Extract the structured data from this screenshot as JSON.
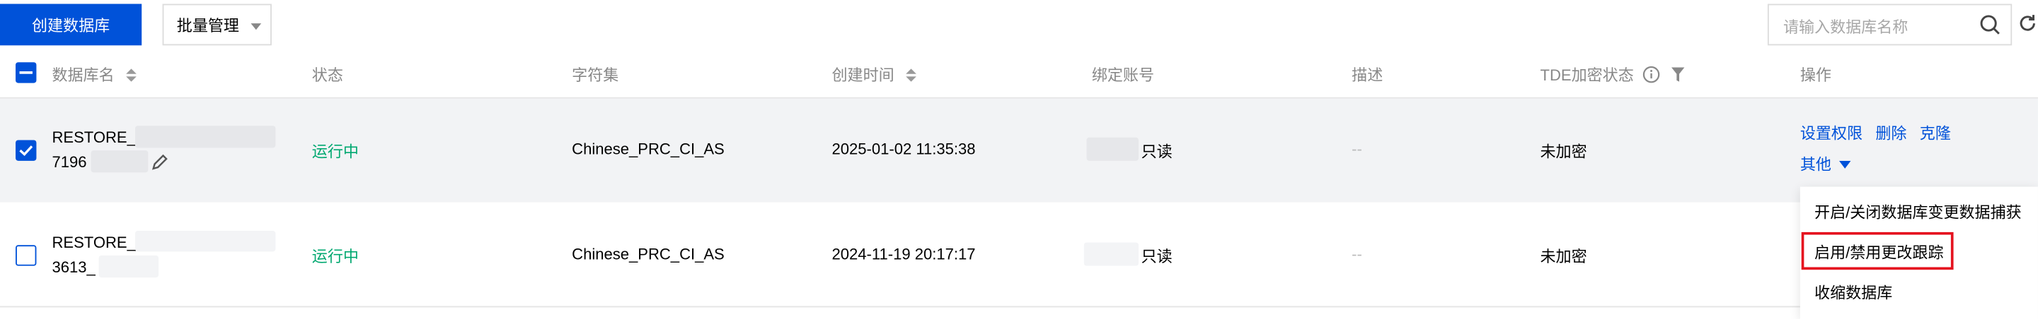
{
  "toolbar": {
    "create_label": "创建数据库",
    "batch_label": "批量管理",
    "search_placeholder": "请输入数据库名称"
  },
  "table": {
    "columns": {
      "name": "数据库名",
      "status": "状态",
      "charset": "字符集",
      "created": "创建时间",
      "account": "绑定账号",
      "desc": "描述",
      "tde": "TDE加密状态",
      "actions": "操作"
    },
    "rows": [
      {
        "name_line1": "RESTORE_",
        "name_line2": "7196",
        "status": "运行中",
        "charset": "Chinese_PRC_CI_AS",
        "created": "2025-01-02 11:35:38",
        "account": "只读",
        "desc": "--",
        "tde": "未加密",
        "checked": true
      },
      {
        "name_line1": "RESTORE_",
        "name_line2": "3613_",
        "status": "运行中",
        "charset": "Chinese_PRC_CI_AS",
        "created": "2024-11-19 20:17:17",
        "account": "只读",
        "desc": "--",
        "tde": "未加密",
        "checked": false
      }
    ],
    "row_actions": {
      "permissions": "设置权限",
      "delete": "删除",
      "clone": "克隆",
      "more": "其他"
    }
  },
  "menu": {
    "items": [
      "开启/关闭数据库变更数据捕获",
      "启用/禁用更改跟踪",
      "收缩数据库"
    ]
  },
  "colors": {
    "primary": "#0052d9",
    "success": "#00a870",
    "highlight": "#e5131f"
  }
}
